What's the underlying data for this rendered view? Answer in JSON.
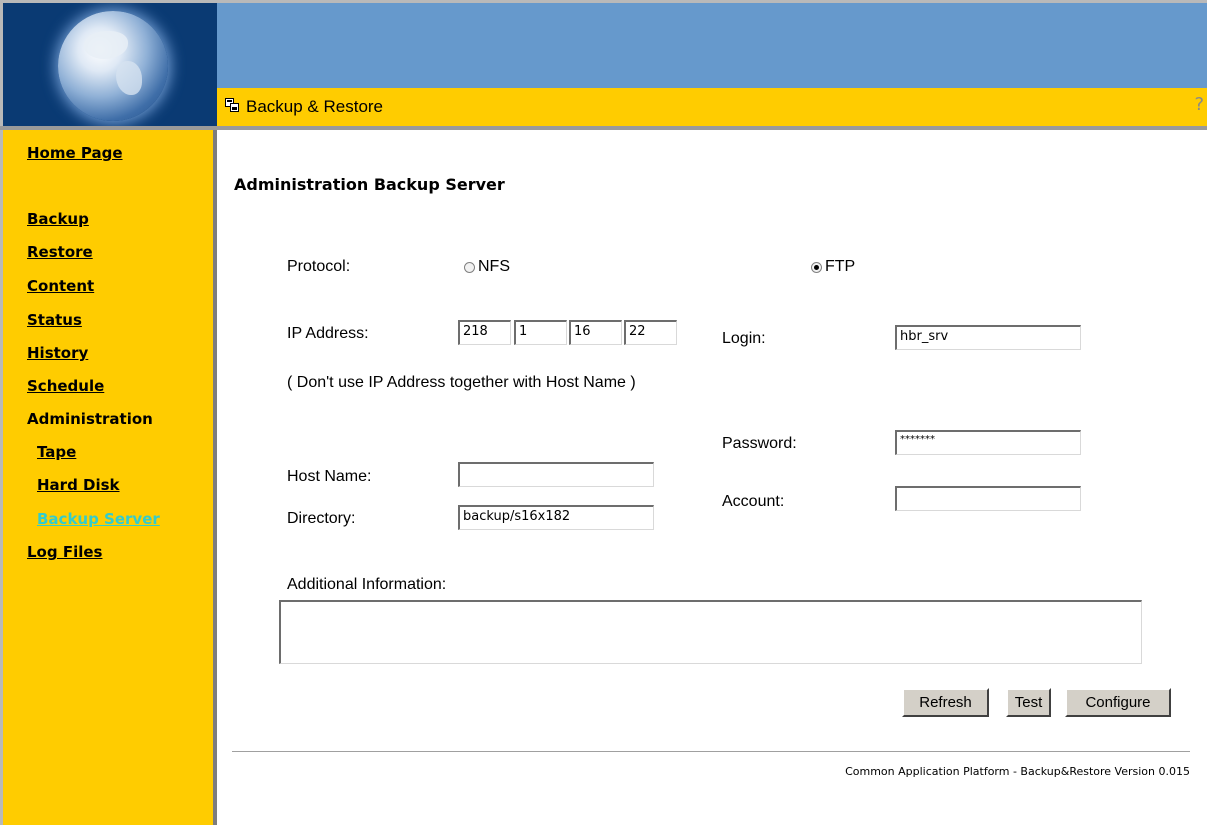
{
  "header": {
    "title": "Backup & Restore",
    "help_glyph": "?",
    "colors": {
      "top": "#6699cc",
      "title_bar": "#ffcc00",
      "sidebar": "#ffcc00",
      "active_link": "#33cccc"
    }
  },
  "sidebar": {
    "home": "Home Page",
    "backup": "Backup",
    "restore": "Restore",
    "content": "Content",
    "status": "Status",
    "history": "History",
    "schedule": "Schedule",
    "administration": "Administration",
    "tape": "Tape",
    "hard_disk": "Hard Disk",
    "backup_server": "Backup Server",
    "log_files": "Log Files"
  },
  "main": {
    "page_title": "Administration Backup Server",
    "protocol_label": "Protocol:",
    "nfs_label": "NFS",
    "ftp_label": "FTP",
    "protocol_selected": "FTP",
    "ip_label": "IP Address:",
    "ip_octets": [
      "218",
      "1",
      "16",
      "22"
    ],
    "ip_note": "( Don't use IP Address together with Host Name )",
    "host_label": "Host Name:",
    "host_value": "",
    "directory_label": "Directory:",
    "directory_value": "backup/s16x182",
    "login_label": "Login:",
    "login_value": "hbr_srv",
    "password_label": "Password:",
    "password_value": "*******",
    "account_label": "Account:",
    "account_value": "",
    "additional_label": "Additional Information:",
    "additional_value": ""
  },
  "buttons": {
    "refresh": "Refresh",
    "test": "Test",
    "configure": "Configure"
  },
  "footer": "Common Application Platform - Backup&Restore Version 0.015"
}
